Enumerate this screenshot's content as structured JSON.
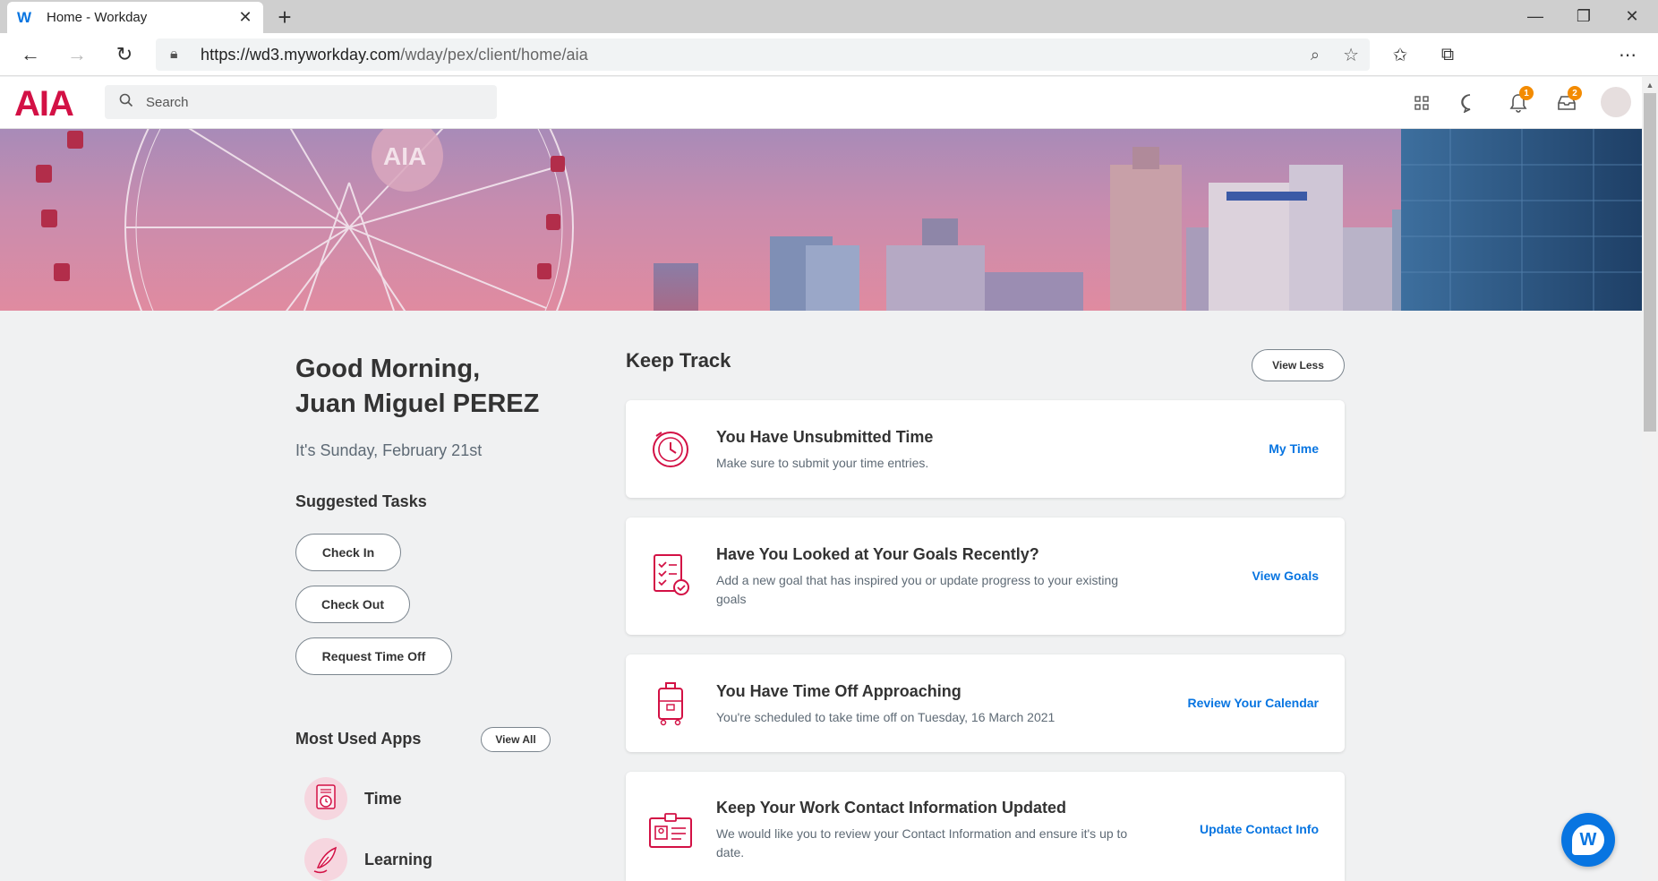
{
  "browser": {
    "tab_title": "Home - Workday",
    "favicon_letter": "W",
    "url_host": "https://wd3.myworkday.com",
    "url_path": "/wday/pex/client/home/aia"
  },
  "header": {
    "logo": "AIA",
    "search_placeholder": "Search",
    "notifications_count": "1",
    "inbox_count": "2"
  },
  "left": {
    "greeting_line1": "Good Morning,",
    "greeting_line2": "Juan Miguel PEREZ",
    "date": "It's Sunday, February 21st",
    "suggested_title": "Suggested Tasks",
    "tasks": [
      "Check In",
      "Check Out",
      "Request Time Off"
    ],
    "apps_title": "Most Used Apps",
    "view_all": "View All",
    "apps": [
      "Time",
      "Learning"
    ]
  },
  "keep_track": {
    "title": "Keep Track",
    "view_less": "View Less",
    "cards": [
      {
        "title": "You Have Unsubmitted Time",
        "desc": "Make sure to submit your time entries.",
        "link": "My Time",
        "icon": "clock-icon"
      },
      {
        "title": "Have You Looked at Your Goals Recently?",
        "desc": "Add a new goal that has inspired you or update progress to your existing goals",
        "link": "View Goals",
        "icon": "checklist-icon"
      },
      {
        "title": "You Have Time Off Approaching",
        "desc": "You're scheduled to take time off on Tuesday, 16 March 2021",
        "link": "Review Your Calendar",
        "icon": "luggage-icon"
      },
      {
        "title": "Keep Your Work Contact Information Updated",
        "desc": "We would like you to review your Contact Information and ensure it's up to date.",
        "link": "Update Contact Info",
        "icon": "id-card-icon"
      }
    ]
  },
  "colors": {
    "brand": "#d31145",
    "link": "#0875e1",
    "badge": "#f38b00"
  }
}
